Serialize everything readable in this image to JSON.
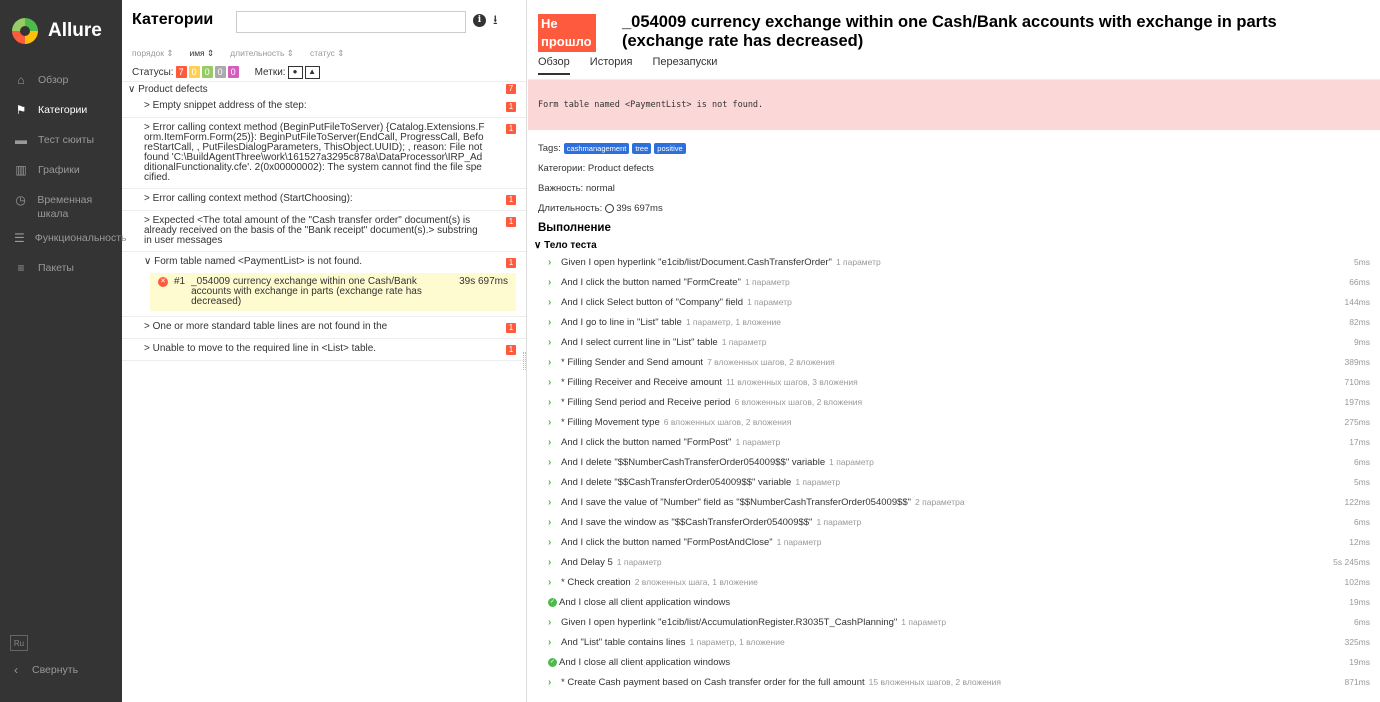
{
  "sidebar": {
    "brand": "Allure",
    "items": [
      {
        "label": "Обзор",
        "active": false
      },
      {
        "label": "Категории",
        "active": true
      },
      {
        "label": "Тест сюиты",
        "active": false
      },
      {
        "label": "Графики",
        "active": false
      },
      {
        "label": "Временная шкала",
        "active": false
      },
      {
        "label": "Функциональность",
        "active": false
      },
      {
        "label": "Пакеты",
        "active": false
      }
    ],
    "lang": "Ru",
    "collapse": "Свернуть"
  },
  "left": {
    "title": "Категории",
    "sort": [
      "порядок ⇕",
      "имя ⇕",
      "длительность ⇕",
      "статус ⇕"
    ],
    "statuses_label": "Статусы:",
    "statuses": [
      "7",
      "0",
      "0",
      "0",
      "0"
    ],
    "marks_label": "Метки:",
    "group": {
      "label": "Product defects",
      "count": "7"
    },
    "nodes": [
      {
        "label": "> Empty snippet address of the step:",
        "count": "1"
      },
      {
        "label": "> Error calling context method (BeginPutFileToServer) {Catalog.Extensions.Form.ItemForm.Form(25)}: BeginPutFileToServer(EndCall, ProgressCall, BeforeStartCall, , PutFilesDialogParameters, ThisObject.UUID); , reason: File not found 'C:\\BuildAgentThree\\work\\161527a3295c878a\\DataProcessor\\IRP_AdditionalFunctionality.cfe'. 2(0x00000002): The system cannot find the file specified.",
        "count": "1"
      },
      {
        "label": "> Error calling context method (StartChoosing):",
        "count": "1"
      },
      {
        "label": "> Expected <The total amount of the \"Cash transfer order\" document(s) is already received on the basis of the \"Bank receipt\" document(s).> substring in user messages",
        "count": "1"
      },
      {
        "label": "∨ Form table named <PaymentList> is not found.",
        "count": "1"
      }
    ],
    "selected": {
      "num": "#1",
      "name": "_054009 currency exchange within one Cash/Bank accounts with exchange in parts (exchange rate has decreased)",
      "duration": "39s 697ms"
    },
    "nodes_after": [
      {
        "label": "> One or more standard table lines are not found in the",
        "count": "1"
      },
      {
        "label": "> Unable to move to the required line in <List> table.",
        "count": "1"
      }
    ]
  },
  "right": {
    "badge": "Не прошло",
    "title": "_054009 currency exchange within one Cash/Bank accounts with exchange in parts (exchange rate has decreased)",
    "tabs": [
      "Обзор",
      "История",
      "Перезапуски"
    ],
    "error": "Form table named <PaymentList> is not found.",
    "tags_label": "Tags:",
    "tags": [
      "cashmanagement",
      "tree",
      "positive"
    ],
    "categories": "Категории: Product defects",
    "severity": "Важность: normal",
    "duration_label": "Длительность:",
    "duration": "39s 697ms",
    "exec_title": "Выполнение",
    "body_title": "∨ Тело теста",
    "steps": [
      {
        "name": "Given I open hyperlink \"e1cib/list/Document.CashTransferOrder\"",
        "extra": "1 параметр",
        "dur": "5ms",
        "icon": "chev"
      },
      {
        "name": "And I click the button named \"FormCreate\"",
        "extra": "1 параметр",
        "dur": "66ms",
        "icon": "chev"
      },
      {
        "name": "And I click Select button of \"Company\" field",
        "extra": "1 параметр",
        "dur": "144ms",
        "icon": "chev"
      },
      {
        "name": "And I go to line in \"List\" table",
        "extra": "1 параметр, 1 вложение",
        "dur": "82ms",
        "icon": "chev"
      },
      {
        "name": "And I select current line in \"List\" table",
        "extra": "1 параметр",
        "dur": "9ms",
        "icon": "chev"
      },
      {
        "name": "* Filling Sender and Send amount",
        "extra": "7 вложенных шагов, 2 вложения",
        "dur": "389ms",
        "icon": "chev"
      },
      {
        "name": "* Filling Receiver and Receive amount",
        "extra": "11 вложенных шагов, 3 вложения",
        "dur": "710ms",
        "icon": "chev"
      },
      {
        "name": "* Filling Send period and Receive period",
        "extra": "6 вложенных шагов, 2 вложения",
        "dur": "197ms",
        "icon": "chev"
      },
      {
        "name": "* Filling Movement type",
        "extra": "6 вложенных шагов, 2 вложения",
        "dur": "275ms",
        "icon": "chev"
      },
      {
        "name": "And I click the button named \"FormPost\"",
        "extra": "1 параметр",
        "dur": "17ms",
        "icon": "chev"
      },
      {
        "name": "And I delete \"$$NumberCashTransferOrder054009$$\" variable",
        "extra": "1 параметр",
        "dur": "6ms",
        "icon": "chev"
      },
      {
        "name": "And I delete \"$$CashTransferOrder054009$$\" variable",
        "extra": "1 параметр",
        "dur": "5ms",
        "icon": "chev"
      },
      {
        "name": "And I save the value of \"Number\" field as \"$$NumberCashTransferOrder054009$$\"",
        "extra": "2 параметра",
        "dur": "122ms",
        "icon": "chev"
      },
      {
        "name": "And I save the window as \"$$CashTransferOrder054009$$\"",
        "extra": "1 параметр",
        "dur": "6ms",
        "icon": "chev"
      },
      {
        "name": "And I click the button named \"FormPostAndClose\"",
        "extra": "1 параметр",
        "dur": "12ms",
        "icon": "chev"
      },
      {
        "name": "And Delay 5",
        "extra": "1 параметр",
        "dur": "5s 245ms",
        "icon": "chev"
      },
      {
        "name": "* Check creation",
        "extra": "2 вложенных шага, 1 вложение",
        "dur": "102ms",
        "icon": "chev"
      },
      {
        "name": "And I close all client application windows",
        "extra": "",
        "dur": "19ms",
        "icon": "ok"
      },
      {
        "name": "Given I open hyperlink \"e1cib/list/AccumulationRegister.R3035T_CashPlanning\"",
        "extra": "1 параметр",
        "dur": "6ms",
        "icon": "chev"
      },
      {
        "name": "And \"List\" table contains lines",
        "extra": "1 параметр, 1 вложение",
        "dur": "325ms",
        "icon": "chev"
      },
      {
        "name": "And I close all client application windows",
        "extra": "",
        "dur": "19ms",
        "icon": "ok"
      },
      {
        "name": "* Create Cash payment based on Cash transfer order for the full amount",
        "extra": "15 вложенных шагов, 2 вложения",
        "dur": "871ms",
        "icon": "chev"
      }
    ]
  },
  "colors": {
    "failed": "#fd5a3e",
    "passed": "#97cc64",
    "broken": "#ffd050",
    "skipped": "#aaaaaa",
    "unknown": "#d35ebe",
    "sidebar": "#343434",
    "tag": "#2e6fdb"
  },
  "icons": {
    "overview": "home-icon",
    "categories": "flag-icon",
    "suites": "briefcase-icon",
    "graphs": "bar-chart-icon",
    "timeline": "clock-icon",
    "behaviors": "list-icon",
    "packages": "align-left-icon"
  }
}
